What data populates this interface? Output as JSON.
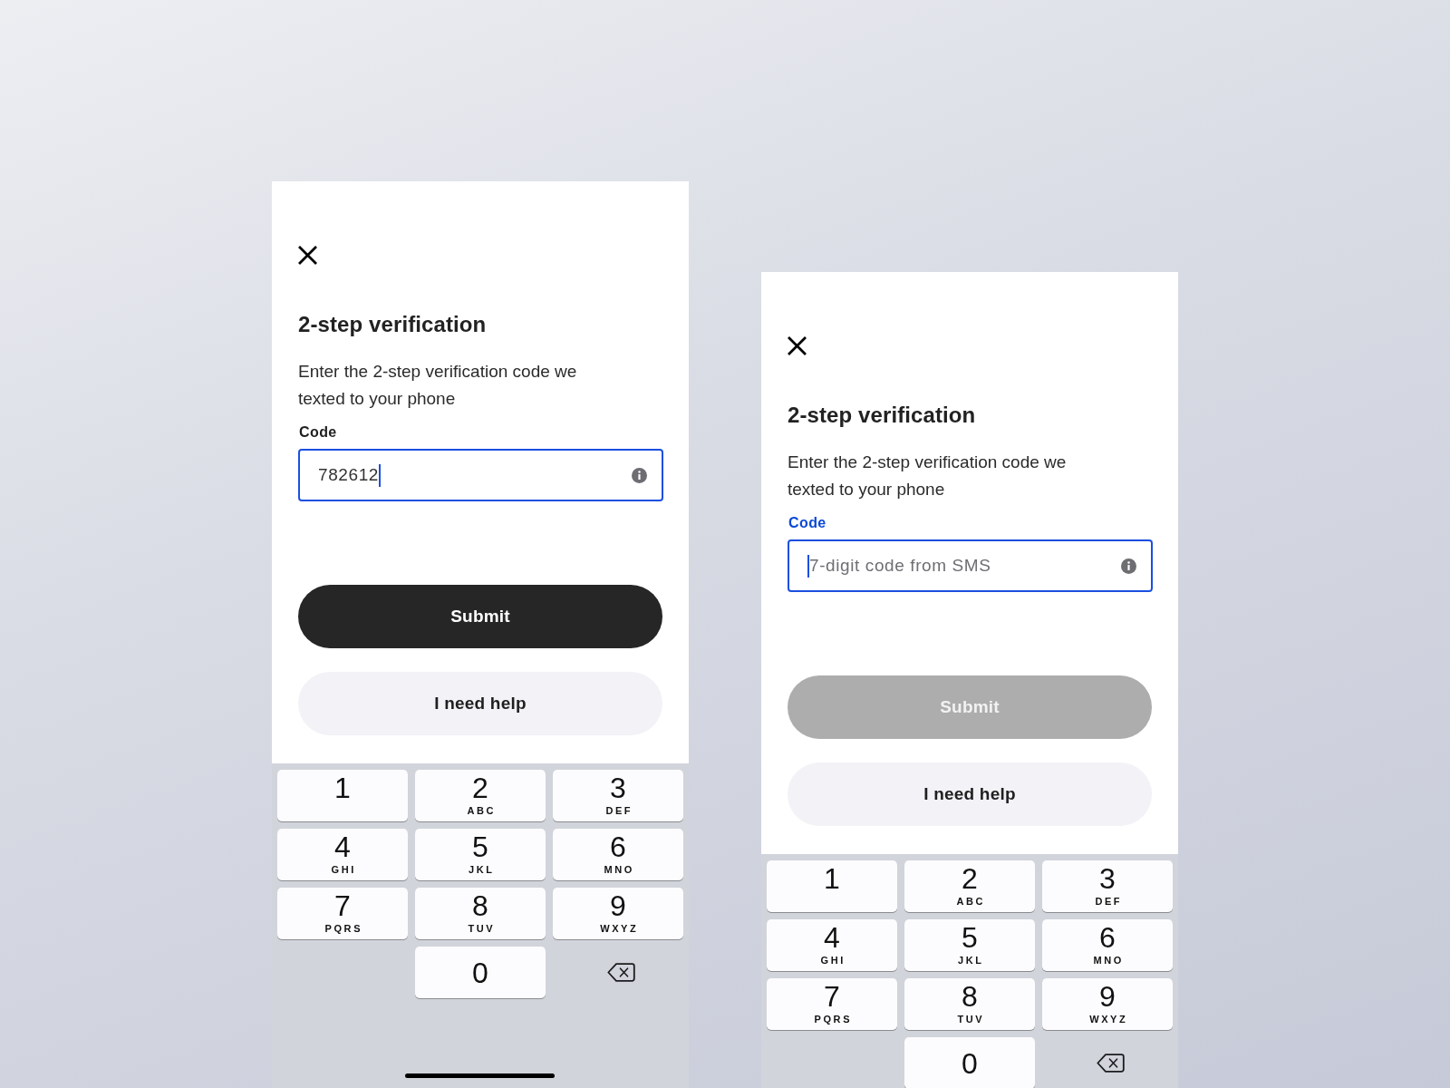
{
  "screens": [
    {
      "title": "2-step verification",
      "description": "Enter the 2-step verification code we texted to your phone",
      "field": {
        "label": "Code",
        "label_highlighted": false,
        "value": "782612",
        "focused": true
      },
      "buttons": [
        {
          "label": "Submit",
          "kind": "primary",
          "disabled": false
        },
        {
          "label": "I need help",
          "kind": "secondary",
          "disabled": false
        }
      ],
      "keypad": [
        {
          "kind": "digit",
          "digit": "1"
        },
        {
          "kind": "digit",
          "digit": "2",
          "letters": "ABC"
        },
        {
          "kind": "digit",
          "digit": "3",
          "letters": "DEF"
        },
        {
          "kind": "digit",
          "digit": "4",
          "letters": "GHI"
        },
        {
          "kind": "digit",
          "digit": "5",
          "letters": "JKL"
        },
        {
          "kind": "digit",
          "digit": "6",
          "letters": "MNO"
        },
        {
          "kind": "digit",
          "digit": "7",
          "letters": "PQRS"
        },
        {
          "kind": "digit",
          "digit": "8",
          "letters": "TUV"
        },
        {
          "kind": "digit",
          "digit": "9",
          "letters": "WXYZ"
        },
        {
          "kind": "spacer"
        },
        {
          "kind": "digit",
          "digit": "0"
        },
        {
          "kind": "delete"
        }
      ],
      "home_indicator": true
    },
    {
      "title": "2-step verification",
      "description": "Enter the 2-step verification code we texted to your phone",
      "field": {
        "label": "Code",
        "label_highlighted": true,
        "placeholder": "7-digit code from SMS",
        "focused": true
      },
      "buttons": [
        {
          "label": "Submit",
          "kind": "primary",
          "disabled": true
        },
        {
          "label": "I need help",
          "kind": "secondary",
          "disabled": false
        }
      ],
      "keypad": [
        {
          "kind": "digit",
          "digit": "1"
        },
        {
          "kind": "digit",
          "digit": "2",
          "letters": "ABC"
        },
        {
          "kind": "digit",
          "digit": "3",
          "letters": "DEF"
        },
        {
          "kind": "digit",
          "digit": "4",
          "letters": "GHI"
        },
        {
          "kind": "digit",
          "digit": "5",
          "letters": "JKL"
        },
        {
          "kind": "digit",
          "digit": "6",
          "letters": "MNO"
        },
        {
          "kind": "digit",
          "digit": "7",
          "letters": "PQRS"
        },
        {
          "kind": "digit",
          "digit": "8",
          "letters": "TUV"
        },
        {
          "kind": "digit",
          "digit": "9",
          "letters": "WXYZ"
        },
        {
          "kind": "spacer"
        },
        {
          "kind": "digit",
          "digit": "0"
        },
        {
          "kind": "delete"
        }
      ]
    }
  ]
}
